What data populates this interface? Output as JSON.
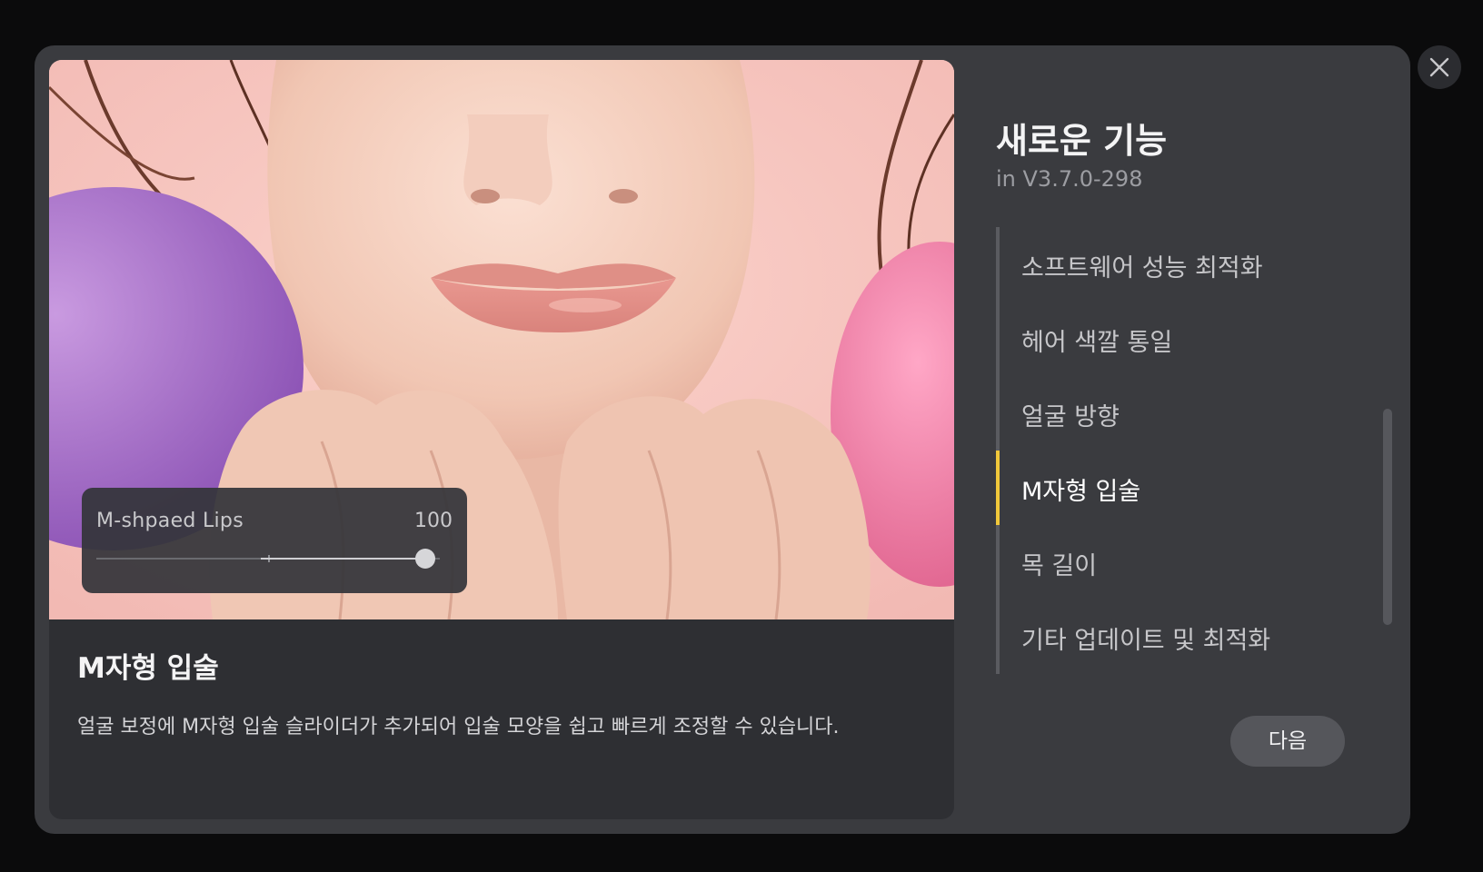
{
  "dialog": {
    "close_icon": "close-icon"
  },
  "preview": {
    "slider": {
      "label": "M-shpaed Lips",
      "value_text": "100",
      "value": 100,
      "min": -100,
      "max": 100
    },
    "feature_title": "M자형 입술",
    "feature_description": "얼굴 보정에 M자형 입술 슬라이더가 추가되어 입술 모양을 쉽고 빠르게 조정할 수 있습니다."
  },
  "sidebar": {
    "title": "새로운 기능",
    "version": "in V3.7.0-298",
    "items": [
      {
        "label": "소프트웨어 성능 최적화",
        "active": false
      },
      {
        "label": "헤어 색깔 통일",
        "active": false
      },
      {
        "label": "얼굴 방향",
        "active": false
      },
      {
        "label": "M자형 입술",
        "active": true
      },
      {
        "label": "목 길이",
        "active": false
      },
      {
        "label": "기타 업데이트 및 최적화",
        "active": false
      }
    ],
    "active_color": "#f0c73a"
  },
  "footer": {
    "next_label": "다음"
  }
}
